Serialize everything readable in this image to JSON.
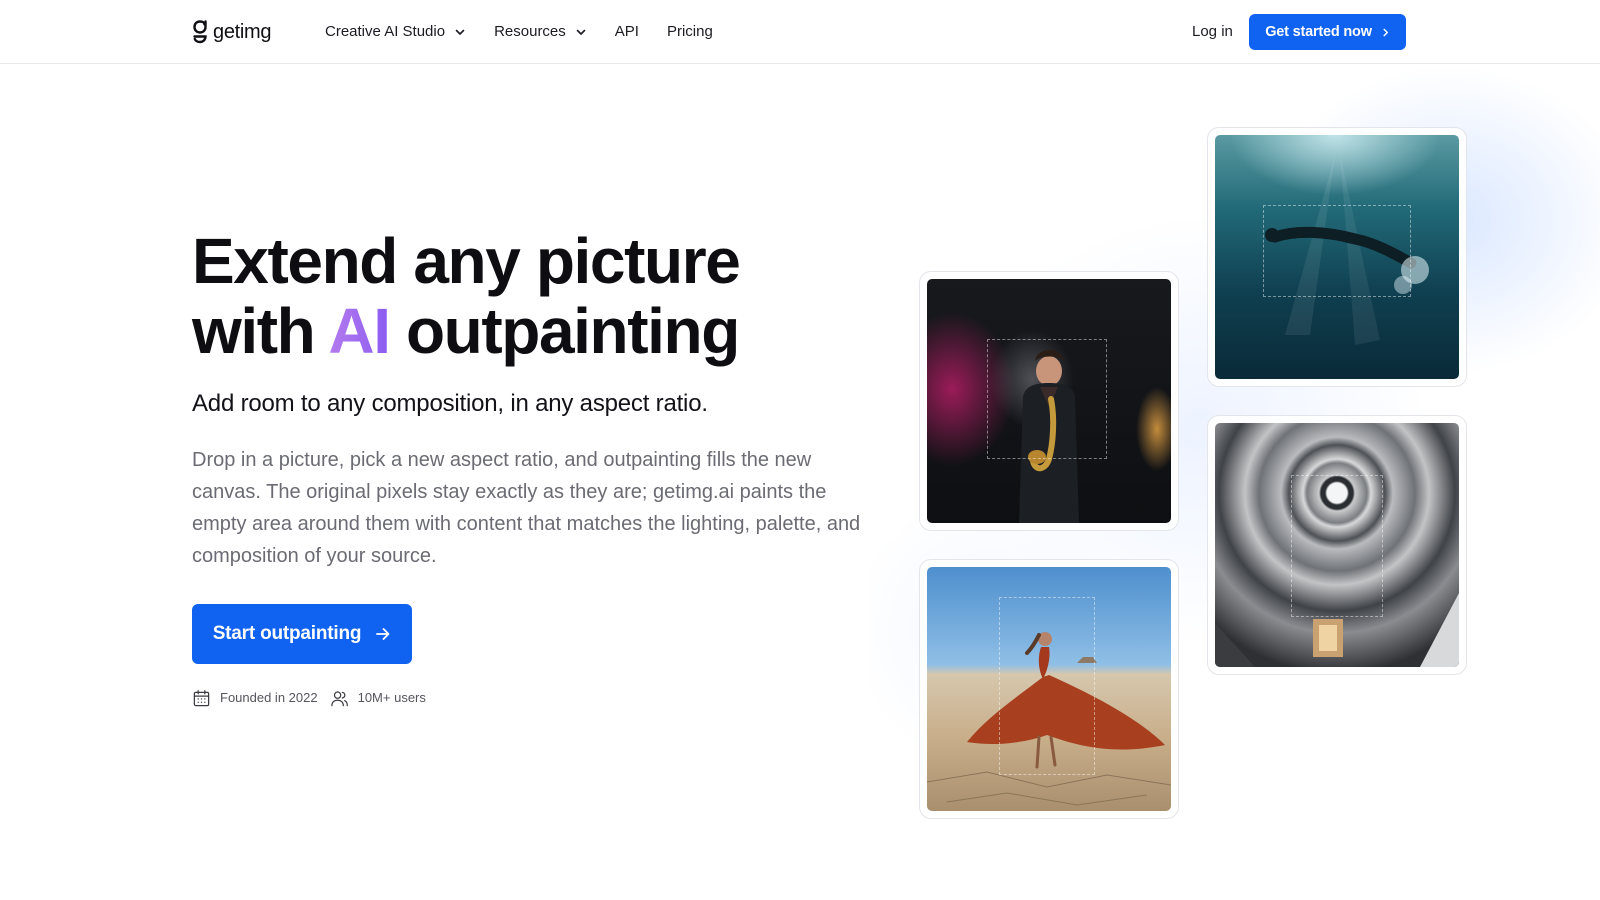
{
  "header": {
    "logo_text": "getimg",
    "nav": [
      {
        "label": "Creative AI Studio",
        "has_dropdown": true
      },
      {
        "label": "Resources",
        "has_dropdown": true
      },
      {
        "label": "API",
        "has_dropdown": false
      },
      {
        "label": "Pricing",
        "has_dropdown": false
      }
    ],
    "login_label": "Log in",
    "cta_label": "Get started now"
  },
  "hero": {
    "title_line1": "Extend any picture",
    "title_line2_pre": "with ",
    "title_line2_accent": "AI",
    "title_line2_post": " outpainting",
    "subtitle": "Add room to any composition, in any aspect ratio.",
    "description": "Drop in a picture, pick a new aspect ratio, and outpainting fills the new canvas. The original pixels stay exactly as they are; getimg.ai paints the empty area around them with content that matches the lighting, palette, and composition of your source.",
    "cta_label": "Start outpainting",
    "meta": {
      "founded": "Founded in 2022",
      "users": "10M+ users"
    }
  },
  "gallery": [
    {
      "name": "saxophonist-photo"
    },
    {
      "name": "underwater-swimmer-photo"
    },
    {
      "name": "spiral-staircase-photo"
    },
    {
      "name": "desert-dancer-photo"
    }
  ],
  "colors": {
    "brand_blue": "#1062f0",
    "accent_gradient_start": "#b57bee",
    "accent_gradient_end": "#8a5cf0",
    "body_text_muted": "#6b6b74"
  }
}
